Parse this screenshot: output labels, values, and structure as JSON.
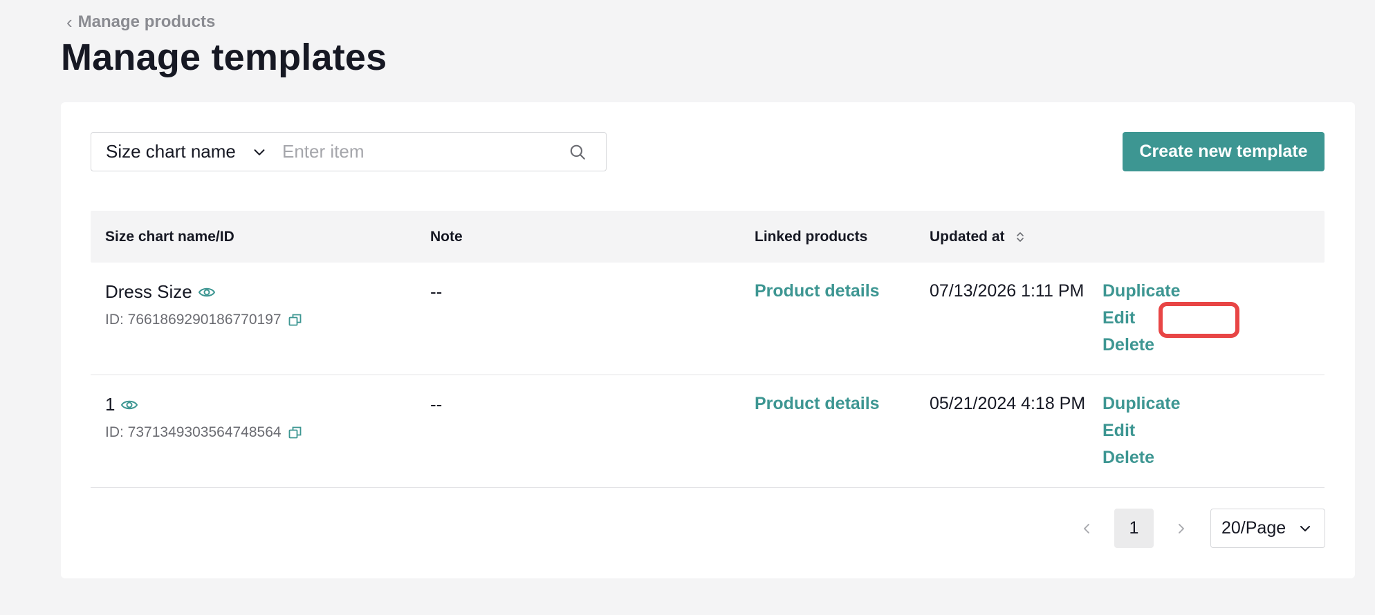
{
  "header": {
    "breadcrumb": "Manage products",
    "title": "Manage templates"
  },
  "search": {
    "type_label": "Size chart name",
    "placeholder": "Enter item"
  },
  "toolbar": {
    "create_label": "Create new template"
  },
  "table": {
    "columns": {
      "name": "Size chart name/ID",
      "note": "Note",
      "linked": "Linked products",
      "updated": "Updated at"
    },
    "rows": [
      {
        "name": "Dress Size",
        "id": "ID: 7661869290186770197",
        "note": "--",
        "linked": "Product details",
        "updated": "07/13/2026 1:11 PM",
        "actions": {
          "duplicate": "Duplicate",
          "edit": "Edit",
          "delete": "Delete"
        }
      },
      {
        "name": "1",
        "id": "ID: 7371349303564748564",
        "note": "--",
        "linked": "Product details",
        "updated": "05/21/2024 4:18 PM",
        "actions": {
          "duplicate": "Duplicate",
          "edit": "Edit",
          "delete": "Delete"
        }
      }
    ]
  },
  "pagination": {
    "current_page": "1",
    "page_size": "20/Page"
  },
  "colors": {
    "accent": "#3d9692",
    "highlight": "#e84545"
  }
}
